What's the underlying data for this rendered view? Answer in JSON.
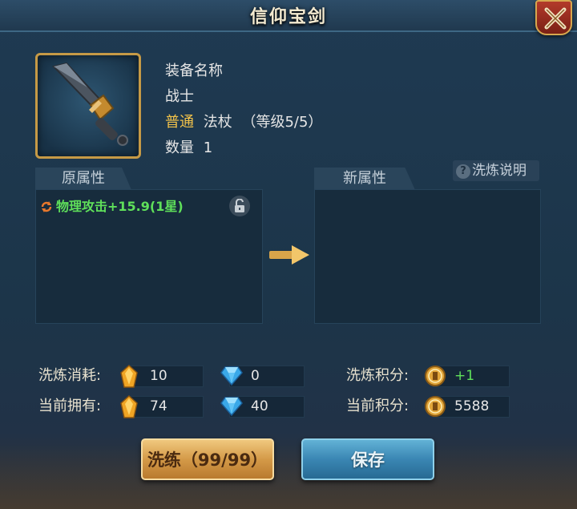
{
  "window": {
    "title": "信仰宝剑",
    "close_icon": "crossed-swords-close-icon"
  },
  "item": {
    "name": "装备名称",
    "profession": "战士",
    "quality": "普通",
    "type": "法杖",
    "level": "（等级5/5）",
    "quantity_label": "数量",
    "quantity": "1",
    "icon": "sword-icon"
  },
  "help_link": "洗炼说明",
  "original_attrs": {
    "tab_label": "原属性",
    "rows": [
      {
        "text": "物理攻击+15.9(1星)",
        "locked": false
      }
    ]
  },
  "new_attrs": {
    "tab_label": "新属性",
    "rows": []
  },
  "cost": {
    "label": "洗炼消耗:",
    "gold": "10",
    "diamond": "0",
    "points_label": "洗炼积分:",
    "points": "+1"
  },
  "owned": {
    "label": "当前拥有:",
    "gold": "74",
    "diamond": "40",
    "points_label": "当前积分:",
    "points": "5588"
  },
  "buttons": {
    "refine": "洗练（99/99）",
    "save": "保存"
  },
  "colors": {
    "quality": "#f2c24a",
    "positive": "#5fe05a",
    "accent_gold": "#c69a46"
  }
}
